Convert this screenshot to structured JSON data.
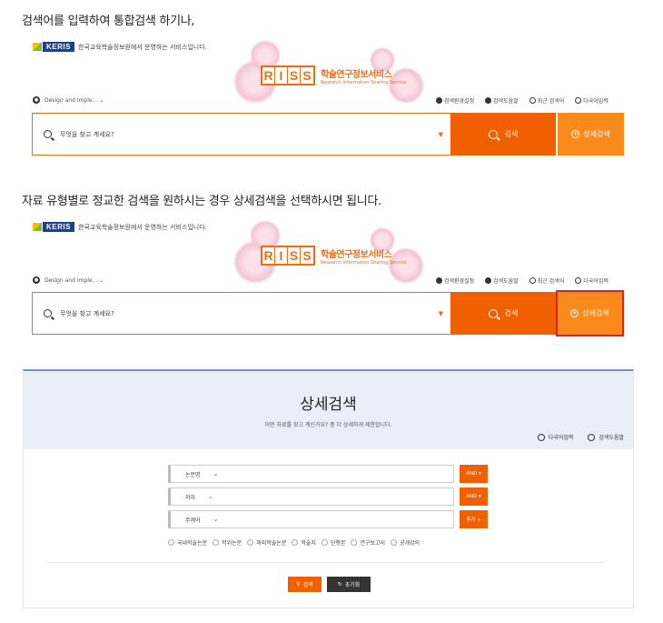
{
  "captions": {
    "first": "검색어를 입력하여 통합검색 하기나,",
    "second": "자료 유형별로 정교한 검색을 원하시는 경우 상세검색을 선택하시면 됩니다."
  },
  "header": {
    "keris_logo": "KERIS",
    "keris_text": "한국교육학술정보원에서 운영하는 서비스입니다.",
    "riss_letters": [
      "R",
      "I",
      "S",
      "S"
    ],
    "riss_title": "학술연구정보서비스",
    "riss_subtitle": "Research Information Sharing Service"
  },
  "search": {
    "scope": "Design and Imple...",
    "placeholder": "무엇을 찾고 계세요?",
    "search_button": "검색",
    "advanced_button": "상세검색",
    "toolbar": [
      "검색환경설정",
      "검색도움말",
      "최근 검색어",
      "다국어입력"
    ]
  },
  "advanced": {
    "title": "상세검색",
    "subtitle": "어떤 자료를 찾고 계신가요? 좀 더 상세하게 제한합니다.",
    "links": [
      "다국어입력",
      "검색도움말"
    ],
    "fields": [
      {
        "label": "논문명",
        "operator": "AND ▾"
      },
      {
        "label": "저자",
        "operator": "AND ▾"
      },
      {
        "label": "주제어",
        "operator": "추가 +"
      }
    ],
    "types": [
      "국내학술논문",
      "학위논문",
      "해외학술논문",
      "학술지",
      "단행본",
      "연구보고서",
      "공개강의"
    ],
    "search_label": "검색",
    "reset_label": "초기화"
  },
  "colors": {
    "accent": "#f06000",
    "accent_light": "#fb8a1d",
    "highlight": "#e0201f",
    "panel_bg": "#e9eef9"
  }
}
